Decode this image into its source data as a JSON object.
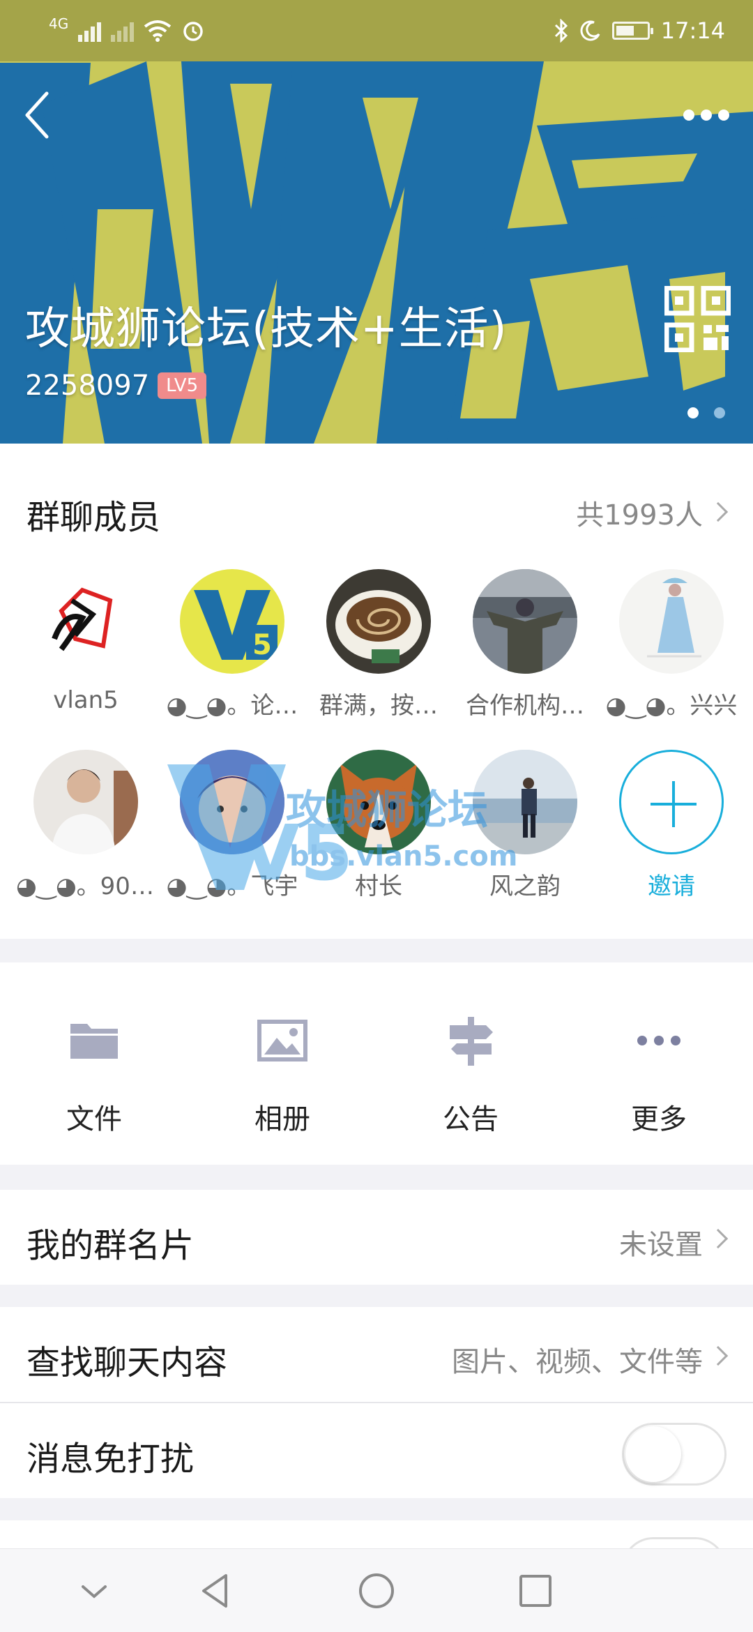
{
  "status_bar": {
    "network": "4G",
    "time": "17:14",
    "battery_level": 0.6
  },
  "header": {
    "group_name": "攻城狮论坛(技术+生活)",
    "group_id": "2258097",
    "level_badge": "LV5",
    "page_dots_count": 2,
    "active_page": 1,
    "colors": {
      "banner_yellow": "#c9c95a",
      "banner_blue": "#1e6fa8"
    }
  },
  "members": {
    "title": "群聊成员",
    "count": "共1993人",
    "list": [
      {
        "name": "vlan5",
        "icon": "vlan5-logo"
      },
      {
        "name": "◕‿◕。论…",
        "icon": "v5-logo"
      },
      {
        "name": "群满，按…",
        "icon": "coffee-cup"
      },
      {
        "name": "合作机构…",
        "icon": "person-crowd"
      },
      {
        "name": "◕‿◕。兴兴",
        "icon": "girl-umbrella"
      },
      {
        "name": "◕‿◕。90r…",
        "icon": "young-man"
      },
      {
        "name": "◕‿◕。飞宇",
        "icon": "child-face"
      },
      {
        "name": "村长",
        "icon": "dog-cartoon"
      },
      {
        "name": "风之韵",
        "icon": "person-seaside"
      }
    ],
    "invite_label": "邀请",
    "accent_color": "#18aedb"
  },
  "watermark": {
    "logo_text": "V5",
    "brand": "攻城狮论坛",
    "url": "bbs.vlan5.com"
  },
  "actions": [
    {
      "label": "文件",
      "icon": "folder-icon"
    },
    {
      "label": "相册",
      "icon": "image-icon"
    },
    {
      "label": "公告",
      "icon": "signpost-icon"
    },
    {
      "label": "更多",
      "icon": "more-icon"
    }
  ],
  "settings": {
    "card": {
      "label": "我的群名片",
      "value": "未设置"
    },
    "search": {
      "label": "查找聊天内容",
      "value": "图片、视频、文件等"
    },
    "mute": {
      "label": "消息免打扰",
      "enabled": false
    }
  }
}
